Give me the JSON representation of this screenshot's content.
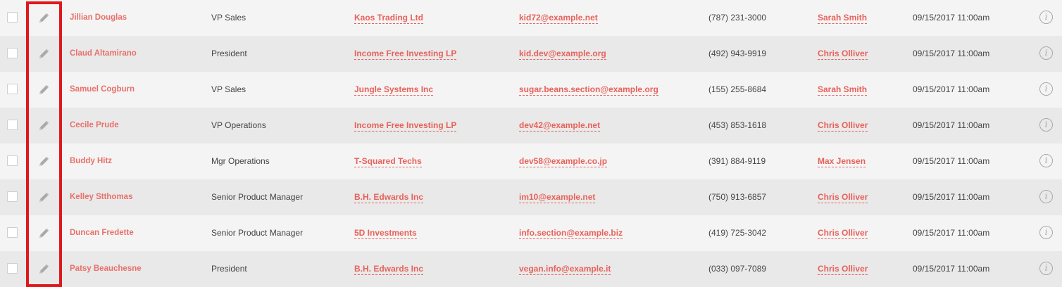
{
  "colors": {
    "link": "#e8615a",
    "row_odd": "#f4f4f4",
    "row_even": "#e9e9e9",
    "highlight": "#e0181c"
  },
  "icons": {
    "edit": "pencil-icon",
    "info": "info-icon"
  },
  "info_glyph": "i",
  "rows": [
    {
      "name": "Jillian Douglas",
      "title": "VP Sales",
      "account": "Kaos Trading Ltd",
      "email": "kid72@example.net",
      "phone": "(787) 231-3000",
      "user": "Sarah Smith",
      "date": "09/15/2017 11:00am"
    },
    {
      "name": "Claud Altamirano",
      "title": "President",
      "account": "Income Free Investing LP",
      "email": "kid.dev@example.org",
      "phone": "(492) 943-9919",
      "user": "Chris Olliver",
      "date": "09/15/2017 11:00am"
    },
    {
      "name": "Samuel Cogburn",
      "title": "VP Sales",
      "account": "Jungle Systems Inc",
      "email": "sugar.beans.section@example.org",
      "phone": "(155) 255-8684",
      "user": "Sarah Smith",
      "date": "09/15/2017 11:00am"
    },
    {
      "name": "Cecile Prude",
      "title": "VP Operations",
      "account": "Income Free Investing LP",
      "email": "dev42@example.net",
      "phone": "(453) 853-1618",
      "user": "Chris Olliver",
      "date": "09/15/2017 11:00am"
    },
    {
      "name": "Buddy Hitz",
      "title": "Mgr Operations",
      "account": "T-Squared Techs",
      "email": "dev58@example.co.jp",
      "phone": "(391) 884-9119",
      "user": "Max Jensen",
      "date": "09/15/2017 11:00am"
    },
    {
      "name": "Kelley Stthomas",
      "title": "Senior Product Manager",
      "account": "B.H. Edwards Inc",
      "email": "im10@example.net",
      "phone": "(750) 913-6857",
      "user": "Chris Olliver",
      "date": "09/15/2017 11:00am"
    },
    {
      "name": "Duncan Fredette",
      "title": "Senior Product Manager",
      "account": "5D Investments",
      "email": "info.section@example.biz",
      "phone": "(419) 725-3042",
      "user": "Chris Olliver",
      "date": "09/15/2017 11:00am"
    },
    {
      "name": "Patsy Beauchesne",
      "title": "President",
      "account": "B.H. Edwards Inc",
      "email": "vegan.info@example.it",
      "phone": "(033) 097-7089",
      "user": "Chris Olliver",
      "date": "09/15/2017 11:00am"
    }
  ]
}
